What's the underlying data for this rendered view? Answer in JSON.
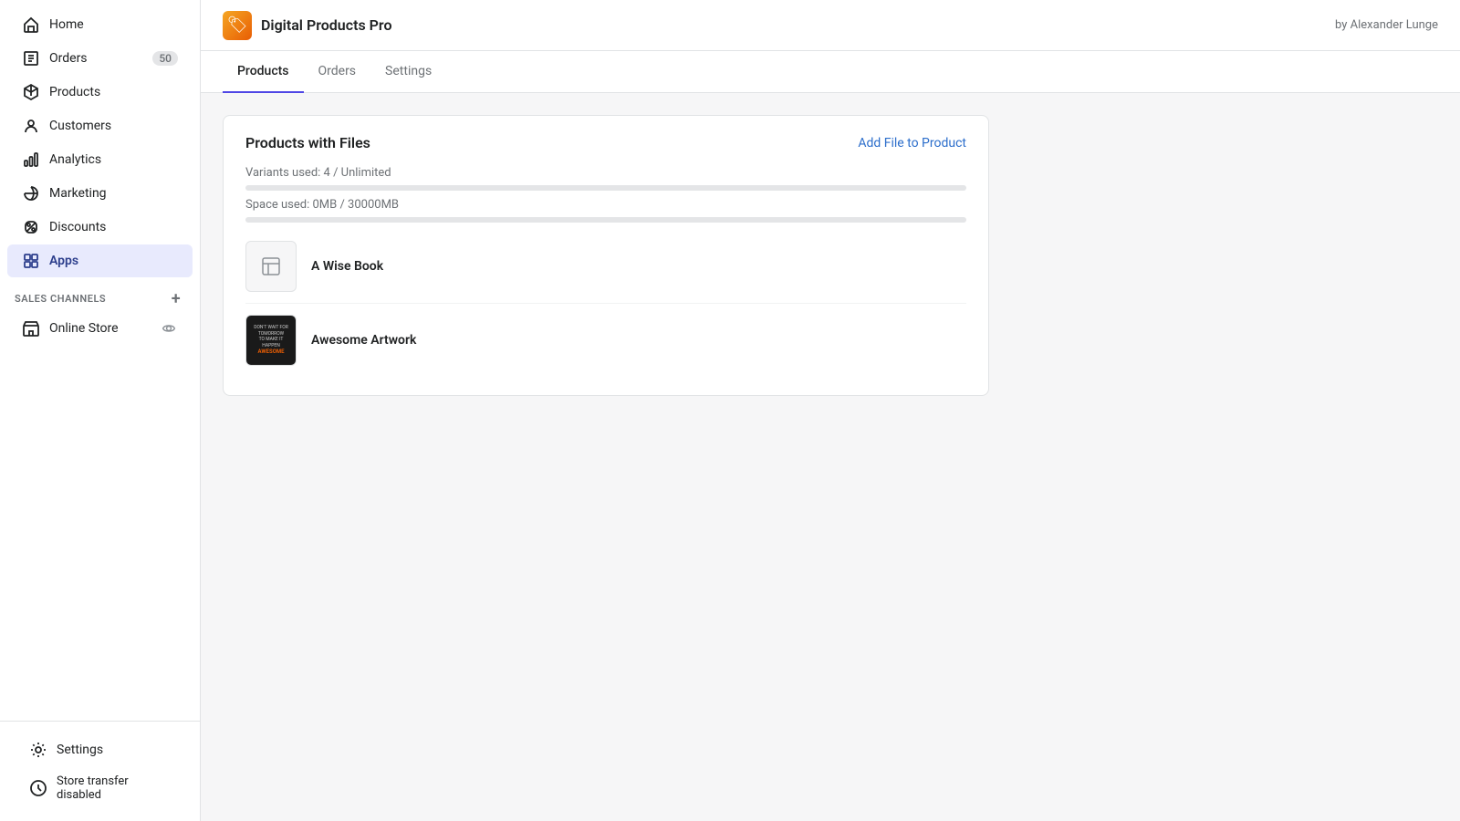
{
  "sidebar": {
    "items": [
      {
        "id": "home",
        "label": "Home",
        "icon": "home",
        "active": false,
        "badge": null
      },
      {
        "id": "orders",
        "label": "Orders",
        "icon": "orders",
        "active": false,
        "badge": "50"
      },
      {
        "id": "products",
        "label": "Products",
        "icon": "products",
        "active": false,
        "badge": null
      },
      {
        "id": "customers",
        "label": "Customers",
        "icon": "customers",
        "active": false,
        "badge": null
      },
      {
        "id": "analytics",
        "label": "Analytics",
        "icon": "analytics",
        "active": false,
        "badge": null
      },
      {
        "id": "marketing",
        "label": "Marketing",
        "icon": "marketing",
        "active": false,
        "badge": null
      },
      {
        "id": "discounts",
        "label": "Discounts",
        "icon": "discounts",
        "active": false,
        "badge": null
      },
      {
        "id": "apps",
        "label": "Apps",
        "icon": "apps",
        "active": true,
        "badge": null
      }
    ],
    "sales_channels_label": "SALES CHANNELS",
    "sales_channels": [
      {
        "id": "online-store",
        "label": "Online Store",
        "icon": "store"
      }
    ],
    "settings_label": "Settings",
    "store_transfer_label": "Store transfer disabled"
  },
  "app_header": {
    "title": "Digital Products Pro",
    "icon": "🏷",
    "by_label": "by Alexander Lunge"
  },
  "tabs": [
    {
      "id": "products",
      "label": "Products",
      "active": true
    },
    {
      "id": "orders",
      "label": "Orders",
      "active": false
    },
    {
      "id": "settings",
      "label": "Settings",
      "active": false
    }
  ],
  "card": {
    "title": "Products with Files",
    "add_file_label": "Add File to Product",
    "variants_used": "Variants used: 4 / Unlimited",
    "space_used": "Space used: 0MB / 30000MB",
    "variants_progress": 0,
    "space_progress": 0,
    "products": [
      {
        "id": "wise-book",
        "name": "A Wise Book",
        "has_image": false
      },
      {
        "id": "awesome-artwork",
        "name": "Awesome Artwork",
        "has_image": true
      }
    ]
  }
}
